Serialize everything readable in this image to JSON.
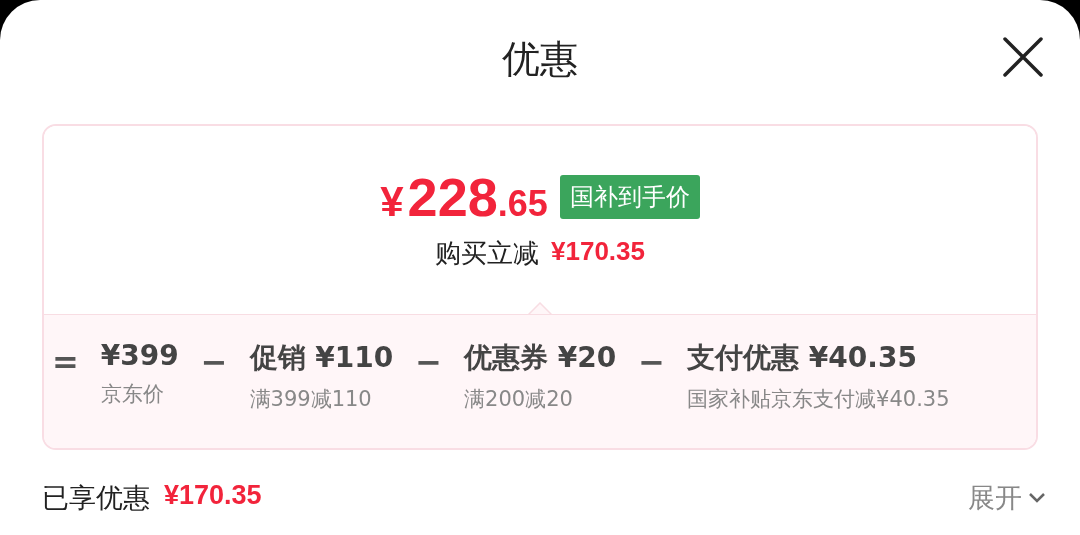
{
  "sheet": {
    "title": "优惠"
  },
  "summary": {
    "currency": "¥",
    "price_int": "228",
    "price_dec": ".65",
    "badge": "国补到手价",
    "saving_label": "购买立减",
    "saving_amount": "¥170.35"
  },
  "breakdown": [
    {
      "operator": "=",
      "title": "¥399",
      "note": "京东价"
    },
    {
      "operator": "−",
      "title": "促销 ¥110",
      "note": "满399减110"
    },
    {
      "operator": "−",
      "title": "优惠券 ¥20",
      "note": "满200减20"
    },
    {
      "operator": "−",
      "title": "支付优惠 ¥40.35",
      "note": "国家补贴京东支付减¥40.35"
    }
  ],
  "footer": {
    "label": "已享优惠",
    "amount": "¥170.35",
    "toggle": "展开"
  }
}
